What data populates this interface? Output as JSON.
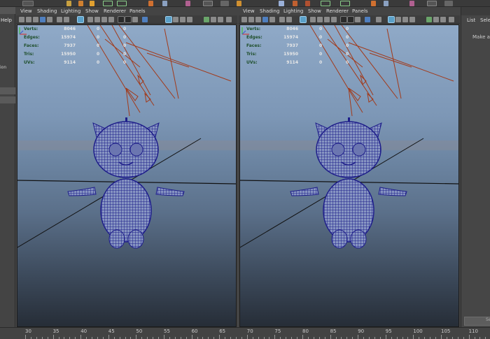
{
  "left_sidebar": {
    "help_menu": "Help",
    "fragment_label": "ion"
  },
  "viewport_menu": [
    "View",
    "Shading",
    "Lighting",
    "Show",
    "Renderer",
    "Panels"
  ],
  "hud": [
    {
      "label": "Verts:",
      "value": "8046",
      "a": "0",
      "b": "0"
    },
    {
      "label": "Edges:",
      "value": "15974",
      "a": "0",
      "b": "0"
    },
    {
      "label": "Faces:",
      "value": "7937",
      "a": "0",
      "b": "0"
    },
    {
      "label": "Tris:",
      "value": "15950",
      "a": "0",
      "b": "0"
    },
    {
      "label": "UVs:",
      "value": "9114",
      "a": "0",
      "b": "0"
    }
  ],
  "right_panel": {
    "menu_list": "List",
    "menu_select": "Selec",
    "hint": "Make a s",
    "button": "Se"
  },
  "time_slider": {
    "ticks": [
      "30",
      "35",
      "40",
      "45",
      "50",
      "55",
      "60",
      "65",
      "70",
      "75",
      "80",
      "85",
      "90",
      "95",
      "100",
      "105",
      "110"
    ]
  },
  "colors": {
    "hud_label": "#1f4f2b",
    "wireframe": "#1a1a8c",
    "light_lines": "#a23a1a",
    "icon_highlight": "#5aa0c8"
  }
}
